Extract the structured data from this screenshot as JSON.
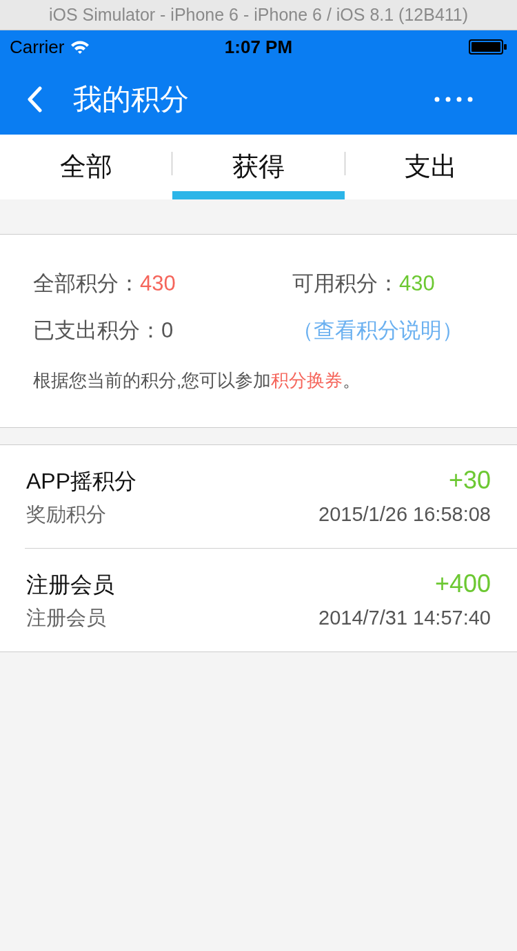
{
  "simulator": {
    "title": "iOS Simulator - iPhone 6 - iPhone 6 / iOS 8.1 (12B411)"
  },
  "status_bar": {
    "carrier": "Carrier",
    "time": "1:07 PM"
  },
  "nav": {
    "title": "我的积分"
  },
  "tabs": [
    {
      "label": "全部",
      "selected": false
    },
    {
      "label": "获得",
      "selected": true
    },
    {
      "label": "支出",
      "selected": false
    }
  ],
  "summary": {
    "total_label": "全部积分：",
    "total_value": "430",
    "available_label": "可用积分：",
    "available_value": "430",
    "spent_label": "已支出积分：",
    "spent_value": "0",
    "rules_link": "（查看积分说明）",
    "note_before": "根据您当前的积分,您可以参加",
    "note_link": "积分换券",
    "note_after": "。"
  },
  "records": [
    {
      "title": "APP摇积分",
      "amount": "+30",
      "subtitle": "奖励积分",
      "time": "2015/1/26 16:58:08"
    },
    {
      "title": "注册会员",
      "amount": "+400",
      "subtitle": "注册会员",
      "time": "2014/7/31 14:57:40"
    }
  ]
}
